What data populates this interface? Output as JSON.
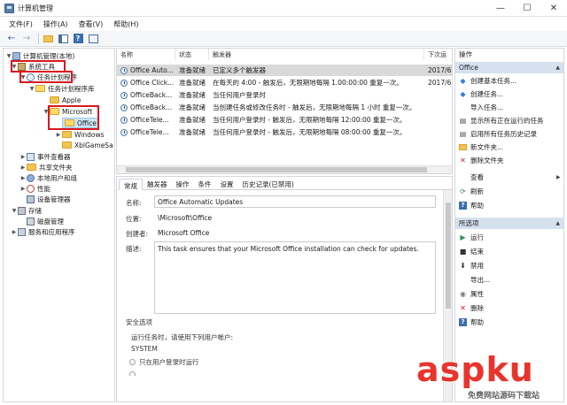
{
  "window": {
    "title": "计算机管理",
    "controls": [
      "—",
      "☐",
      "✕"
    ]
  },
  "menu": [
    "文件(F)",
    "操作(A)",
    "查看(V)",
    "帮助(H)"
  ],
  "toolbar": {
    "icons": [
      "back-arrow-icon",
      "forward-arrow-icon",
      "up-folder-icon",
      "show-hide-tree-icon",
      "help-icon",
      "properties-icon"
    ]
  },
  "tree": {
    "root": "计算机管理(本地)",
    "system_tools": "系统工具",
    "task_scheduler": "任务计划程序",
    "task_library": "任务计划程序库",
    "apple": "Apple",
    "microsoft": "Microsoft",
    "office": "Office",
    "windows": "Windows",
    "xbl": "XblGameSa",
    "event_viewer": "事件查看器",
    "shared_folders": "共享文件夹",
    "local_users": "本地用户和组",
    "performance": "性能",
    "device_manager": "设备管理器",
    "storage": "存储",
    "disk_mgmt": "磁盘管理",
    "services_apps": "服务和应用程序"
  },
  "list": {
    "headers": [
      "名称",
      "状态",
      "触发器",
      "下次运"
    ],
    "rows": [
      {
        "name": "Office Auto...",
        "status": "准备就绪",
        "trigger": "已定义多个触发器",
        "next": "2017/6",
        "selected": true
      },
      {
        "name": "Office Click...",
        "status": "准备就绪",
        "trigger": "在每天的 4:00 - 触发后，无限期地每隔 1.00:00:00 重复一次。",
        "next": "2017/6",
        "selected": false
      },
      {
        "name": "OfficeBack...",
        "status": "准备就绪",
        "trigger": "当任何用户登录时",
        "next": "",
        "selected": false
      },
      {
        "name": "OfficeBack...",
        "status": "准备就绪",
        "trigger": "当创建任务或修改任务时 - 触发后，无限期地每隔 1 小时 重复一次。",
        "next": "",
        "selected": false
      },
      {
        "name": "OfficeTele...",
        "status": "准备就绪",
        "trigger": "当任何用户登录时 - 触发后，无限期地每隔 12:00:00 重复一次。",
        "next": "",
        "selected": false
      },
      {
        "name": "OfficeTele...",
        "status": "准备就绪",
        "trigger": "当任何用户登录时 - 触发后，无限期地每隔 08:00:00 重复一次。",
        "next": "",
        "selected": false
      }
    ]
  },
  "detail": {
    "tabs": [
      "常规",
      "触发器",
      "操作",
      "条件",
      "设置",
      "历史记录(已禁用)"
    ],
    "name_label": "名称:",
    "name_value": "Office Automatic Updates",
    "location_label": "位置:",
    "location_value": "\\Microsoft\\Office",
    "author_label": "创建者:",
    "author_value": "Microsoft Office",
    "desc_label": "描述:",
    "desc_value": "This task ensures that your Microsoft Office installation can check for updates.",
    "security_label": "安全选项",
    "run_as_label": "运行任务时，请使用下列用户帐户:",
    "run_as_value": "SYSTEM",
    "option1": "只在用户登录时运行"
  },
  "actions": {
    "header": "操作",
    "section1": "Office",
    "items1": [
      {
        "label": "创建基本任务...",
        "icon": "create-basic-task-icon",
        "color": "#3a7bd5"
      },
      {
        "label": "创建任务...",
        "icon": "create-task-icon",
        "color": "#3a7bd5"
      },
      {
        "label": "导入任务...",
        "icon": "import-task-icon",
        "color": "#555555"
      },
      {
        "label": "显示所有正在运行的任务",
        "icon": "running-tasks-icon",
        "color": "#555555"
      },
      {
        "label": "启用所有任务历史记录",
        "icon": "enable-history-icon",
        "color": "#555555"
      },
      {
        "label": "新文件夹...",
        "icon": "new-folder-icon",
        "color": "#e0b030"
      },
      {
        "label": "删除文件夹",
        "icon": "delete-folder-icon",
        "color": "#d9171f"
      },
      {
        "label": "查看",
        "icon": "view-icon",
        "color": "#555555"
      },
      {
        "label": "刷新",
        "icon": "refresh-icon",
        "color": "#2e8b57"
      },
      {
        "label": "帮助",
        "icon": "help-icon",
        "color": "#3a5f9a"
      }
    ],
    "section2": "所选项",
    "items2": [
      {
        "label": "运行",
        "icon": "run-icon",
        "color": "#2e8b57"
      },
      {
        "label": "结束",
        "icon": "end-icon",
        "color": "#333333"
      },
      {
        "label": "禁用",
        "icon": "disable-icon",
        "color": "#333333"
      },
      {
        "label": "导出...",
        "icon": "export-icon",
        "color": "#555555"
      },
      {
        "label": "属性",
        "icon": "properties-icon",
        "color": "#555555"
      },
      {
        "label": "删除",
        "icon": "delete-icon",
        "color": "#d9171f"
      },
      {
        "label": "帮助",
        "icon": "help-icon",
        "color": "#3a5f9a"
      }
    ]
  },
  "watermark": {
    "logo": "aspku",
    "subtitle": "免费网站源码下载站"
  }
}
